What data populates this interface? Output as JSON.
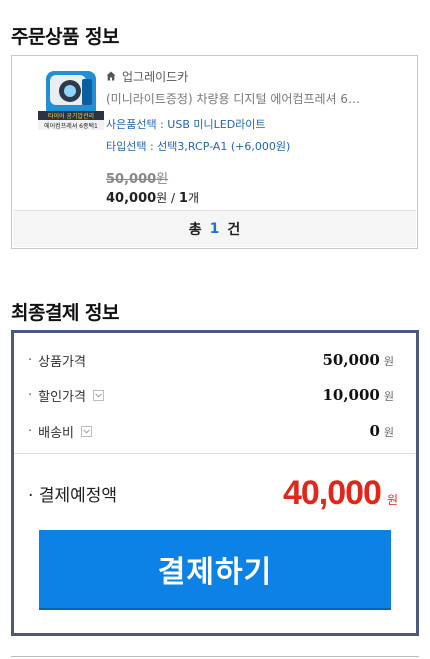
{
  "order_section": {
    "title": "주문상품 정보",
    "item": {
      "store": "업그레이드카",
      "name": "(미니라이트증정) 차량용 디지털 에어컴프레셔 6…",
      "options": [
        "사은품선택 : USB 미니LED라이트",
        "타입선택 : 선택3,RCP-A1 (+6,000원)"
      ],
      "original_price": "50,000",
      "original_unit": "원",
      "sale_price": "40,000",
      "sale_unit": "원",
      "separator": " / ",
      "quantity": "1",
      "quantity_unit": "개",
      "thumbnail_caption_1": "타이어 공기압관리",
      "thumbnail_caption_2": "에어컴프레셔 6종택1"
    },
    "total": {
      "prefix": "총",
      "count": "1",
      "suffix": "건"
    }
  },
  "payment_section": {
    "title": "최종결제 정보",
    "rows": {
      "price": {
        "bullet": "·",
        "label": "상품가격",
        "value": "50,000",
        "currency": "원"
      },
      "discount": {
        "bullet": "·",
        "label": "할인가격",
        "value": "10,000",
        "currency": "원"
      },
      "shipping": {
        "bullet": "·",
        "label": "배송비",
        "value": "0",
        "currency": "원"
      }
    },
    "expected": {
      "bullet": "·",
      "label": "결제예정액",
      "value": "40,000",
      "currency": "원"
    },
    "pay_button": "결제하기"
  },
  "colors": {
    "accent_blue": "#0c82e6",
    "price_red": "#e1261c",
    "border_navy": "#4a5a78",
    "option_blue": "#2366b4"
  }
}
